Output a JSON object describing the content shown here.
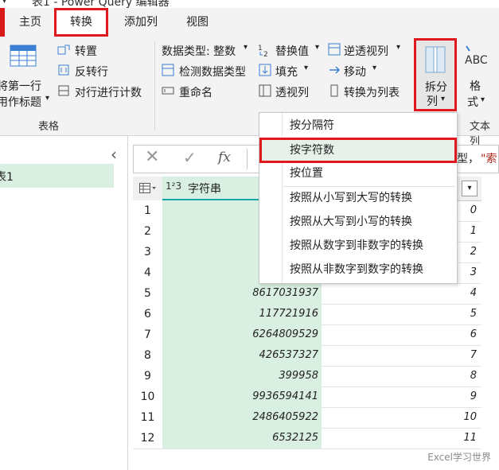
{
  "window": {
    "title": "表1 - Power Query 编辑器"
  },
  "tabs": [
    {
      "label": "主页"
    },
    {
      "label": "转换"
    },
    {
      "label": "添加列"
    },
    {
      "label": "视图"
    }
  ],
  "ribbon": {
    "table_group": {
      "use_first_row_line1": "将第一行",
      "use_first_row_line2": "用作标题",
      "transpose": "转置",
      "reverse_rows": "反转行",
      "count_rows": "对行进行计数",
      "label": "表格"
    },
    "any_column": {
      "data_type": "数据类型: 整数",
      "detect_type": "检测数据类型",
      "rename": "重命名",
      "replace_values": "替换值",
      "fill": "填充",
      "pivot": "透视列",
      "unpivot": "逆透视列",
      "move": "移动",
      "convert_to_list": "转换为列表"
    },
    "split_column_line1": "拆分",
    "split_column_line2": "列",
    "format_line1": "格",
    "format_line2": "式",
    "text_column_label": "文本列"
  },
  "formula_bar": {
    "fx": "fx",
    "tail_text": "型，",
    "tail_text2": "\"索"
  },
  "left_pane": {
    "query_name": "表1",
    "collapse_glyph": "‹"
  },
  "grid": {
    "column1_type": "1²3",
    "column1_name": "字符串",
    "rows": [
      {
        "n": "1",
        "c1": "",
        "c2": "0"
      },
      {
        "n": "2",
        "c1": "",
        "c2": "1"
      },
      {
        "n": "3",
        "c1": "",
        "c2": "2"
      },
      {
        "n": "4",
        "c1": "",
        "c2": "3"
      },
      {
        "n": "5",
        "c1": "8617031937",
        "c2": "4"
      },
      {
        "n": "6",
        "c1": "117721916",
        "c2": "5"
      },
      {
        "n": "7",
        "c1": "6264809529",
        "c2": "6"
      },
      {
        "n": "8",
        "c1": "426537327",
        "c2": "7"
      },
      {
        "n": "9",
        "c1": "399958",
        "c2": "8"
      },
      {
        "n": "10",
        "c1": "9936594141",
        "c2": "9"
      },
      {
        "n": "11",
        "c1": "2486405922",
        "c2": "10"
      },
      {
        "n": "12",
        "c1": "6532125",
        "c2": "11"
      }
    ]
  },
  "split_menu": {
    "items": [
      {
        "label": "按分隔符"
      },
      {
        "label": "按字符数"
      },
      {
        "label": "按位置"
      },
      {
        "label": "按照从小写到大写的转换"
      },
      {
        "label": "按照从大写到小写的转换"
      },
      {
        "label": "按照从数字到非数字的转换"
      },
      {
        "label": "按照从非数字到数字的转换"
      }
    ]
  },
  "watermark": "Excel学习世界",
  "colors": {
    "highlight_red": "#e0191f",
    "column_green": "#d9efe1",
    "teal_underline": "#1aa6a0"
  }
}
